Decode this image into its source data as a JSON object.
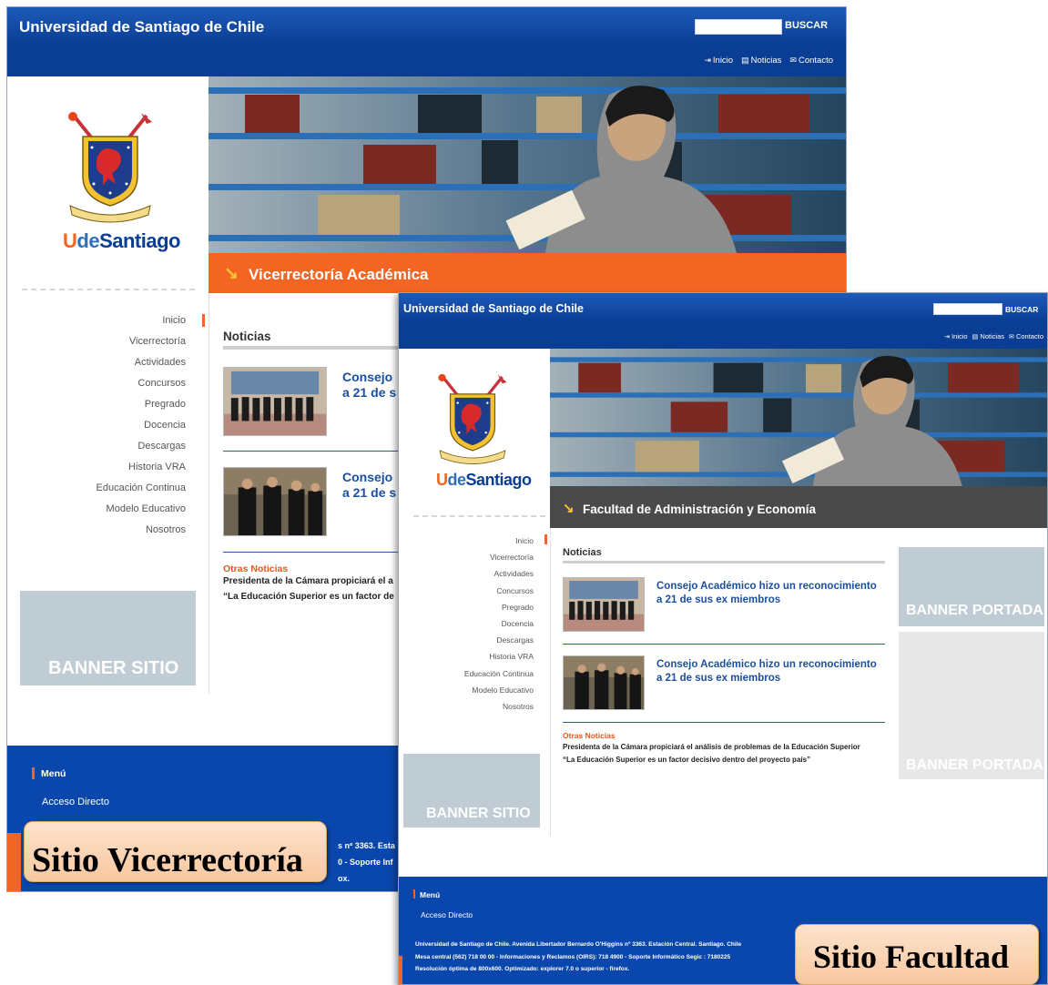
{
  "site_header": {
    "title": "Universidad de Santiago de Chile",
    "search_button": "BUSCAR",
    "links": [
      {
        "icon": "enter-icon",
        "label": "Inicio"
      },
      {
        "icon": "document-icon",
        "label": "Noticias"
      },
      {
        "icon": "envelope-icon",
        "label": "Contacto"
      }
    ]
  },
  "logo": {
    "brand_u": "U",
    "brand_de": "de",
    "brand_santiago": "Santiago"
  },
  "sections": {
    "vicerrectoria": "Vicerrectoría Académica",
    "facultad": "Facultad de Administración y Economía"
  },
  "menu": [
    "Inicio",
    "Vicerrectoría",
    "Actividades",
    "Concursos",
    "Pregrado",
    "Docencia",
    "Descargas",
    "Historia VRA",
    "Educación Continua",
    "Modelo Educativo",
    "Nosotros"
  ],
  "banners": {
    "sitio": "BANNER SITIO",
    "portada": "BANNER PORTADA"
  },
  "noticias": {
    "heading": "Noticias",
    "items": [
      {
        "line1": "Consejo Académico hizo un reconocimiento",
        "line2": "a 21 de sus ex miembros",
        "line1_cut": "Consejo",
        "line2_cut": "a 21 de s"
      },
      {
        "line1": "Consejo Académico hizo un reconocimiento",
        "line2": "a 21 de sus ex miembros",
        "line1_cut": "Consejo",
        "line2_cut": "a 21 de s"
      }
    ],
    "otras_heading": "Otras Noticias",
    "otras": [
      "Presidenta de la Cámara propiciará el análisis de problemas de la Educación Superior",
      "“La Educación Superior es un factor decisivo dentro del proyecto país”"
    ],
    "otras_cut": [
      "Presidenta de la Cámara propiciará el a",
      "“La Educación Superior es un factor de"
    ]
  },
  "footer": {
    "menu_title": "Menú",
    "link": "Acceso Directo",
    "lines": [
      "Universidad de Santiago de Chile. Avenida Libertador Bernardo O'Higgins nº 3363. Estación Central. Santiago. Chile",
      "Mesa central (562) 718 00 00 - Informaciones y Reclamos (OIRS): 718 4900 - Soporte Informático Segic : 7180225",
      "Resolución óptima de 800x600. Optimizado: explorer 7.0 o superior - firefox."
    ],
    "lines_cut": [
      "s nº 3363. Esta",
      "0 - Soporte Inf",
      "ox."
    ]
  },
  "captions": {
    "vicerrectoria": "Sitio Vicerrectoría",
    "facultad": "Sitio Facultad"
  },
  "colors": {
    "header_blue": "#0a3d94",
    "accent_orange": "#f26522",
    "section_grey": "#4a4a4a",
    "banner_grey": "#c0ccd4",
    "title_blue": "#1b4f9c"
  }
}
